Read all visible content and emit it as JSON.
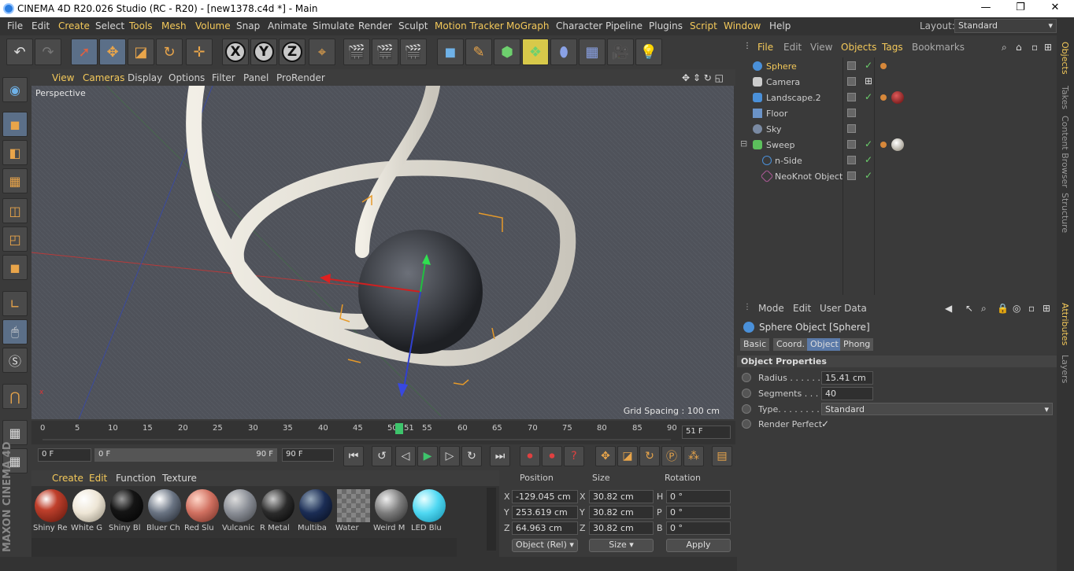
{
  "window": {
    "title": "CINEMA 4D R20.026 Studio (RC - R20) - [new1378.c4d *] - Main",
    "minimize": "—",
    "maximize": "❐",
    "close": "✕"
  },
  "menubar": {
    "items": [
      "File",
      "Edit",
      "Create",
      "Select",
      "Tools",
      "Mesh",
      "Volume",
      "Snap",
      "Animate",
      "Simulate",
      "Render",
      "Sculpt",
      "Motion Tracker",
      "MoGraph",
      "Character",
      "Pipeline",
      "Plugins",
      "Script",
      "Window",
      "Help"
    ],
    "layout_label": "Layout:",
    "layout_value": "Standard"
  },
  "viewport_menu": [
    "View",
    "Cameras",
    "Display",
    "Options",
    "Filter",
    "Panel",
    "ProRender"
  ],
  "viewport": {
    "label": "Perspective",
    "grid_spacing": "Grid Spacing : 100 cm"
  },
  "timeline": {
    "ticks": [
      "0",
      "5",
      "10",
      "15",
      "20",
      "25",
      "30",
      "35",
      "40",
      "45",
      "50",
      "51",
      "55",
      "60",
      "65",
      "70",
      "75",
      "80",
      "85",
      "90"
    ],
    "current_frame": "51 F",
    "start_field": "0 F",
    "range_start": "0 F",
    "range_end": "90 F",
    "end_field": "90 F"
  },
  "material_menu": [
    "Create",
    "Edit",
    "Function",
    "Texture"
  ],
  "materials": [
    {
      "name": "Shiny Re",
      "color": "#c0402c"
    },
    {
      "name": "White G",
      "color": "#eee6d6"
    },
    {
      "name": "Shiny Bl",
      "color": "#151515"
    },
    {
      "name": "Bluer Ch",
      "color": "#6a7483"
    },
    {
      "name": "Red Slu",
      "color": "#d07060"
    },
    {
      "name": "Vulcanic",
      "color": "#8a8e96"
    },
    {
      "name": "R Metal",
      "color": "#2b2b2b"
    },
    {
      "name": "Multiba",
      "color": "#1b2d55"
    },
    {
      "name": "Water",
      "color": "#707070"
    },
    {
      "name": "Weird M",
      "color": "#7d7d7d"
    },
    {
      "name": "LED Blu",
      "color": "#4fd8f2"
    }
  ],
  "coords": {
    "headers": [
      "Position",
      "Size",
      "Rotation"
    ],
    "rows": [
      {
        "axis": "X",
        "pos": "-129.045 cm",
        "saxis": "X",
        "size": "30.82 cm",
        "raxis": "H",
        "rot": "0 °"
      },
      {
        "axis": "Y",
        "pos": "253.619 cm",
        "saxis": "Y",
        "size": "30.82 cm",
        "raxis": "P",
        "rot": "0 °"
      },
      {
        "axis": "Z",
        "pos": "64.963 cm",
        "saxis": "Z",
        "size": "30.82 cm",
        "raxis": "B",
        "rot": "0 °"
      }
    ],
    "mode": "Object (Rel)",
    "size_mode": "Size",
    "apply": "Apply"
  },
  "object_menu": [
    "File",
    "Edit",
    "View",
    "Objects",
    "Tags",
    "Bookmarks"
  ],
  "objects": [
    {
      "name": "Sphere",
      "selected": true,
      "icon_color": "#4a90d9",
      "indent": 0
    },
    {
      "name": "Camera",
      "selected": false,
      "icon_color": "#cccccc",
      "indent": 0
    },
    {
      "name": "Landscape.2",
      "selected": false,
      "icon_color": "#4a90d9",
      "indent": 0
    },
    {
      "name": "Floor",
      "selected": false,
      "icon_color": "#6b93c7",
      "indent": 0
    },
    {
      "name": "Sky",
      "selected": false,
      "icon_color": "#7a8aa3",
      "indent": 0
    },
    {
      "name": "Sweep",
      "selected": false,
      "icon_color": "#5cc05c",
      "indent": 0
    },
    {
      "name": "n-Side",
      "selected": false,
      "icon_color": "#4a90d9",
      "indent": 1
    },
    {
      "name": "NeoKnot Object",
      "selected": false,
      "icon_color": "#b05a9a",
      "indent": 1
    }
  ],
  "attr_menu": [
    "Mode",
    "Edit",
    "User Data"
  ],
  "attributes": {
    "title": "Sphere Object [Sphere]",
    "tabs": [
      "Basic",
      "Coord.",
      "Object",
      "Phong"
    ],
    "active_tab": "Object",
    "section": "Object Properties",
    "props": [
      {
        "label": "Radius . . . . . . .",
        "value": "15.41 cm"
      },
      {
        "label": "Segments . . . .",
        "value": "40"
      },
      {
        "label": "Type. . . . . . . . .",
        "value": "Standard"
      },
      {
        "label": "Render Perfect",
        "value": "✓"
      }
    ]
  },
  "right_tabs": [
    "Objects",
    "Takes",
    "Content Browser",
    "Structure",
    "Attributes",
    "Layers"
  ],
  "brand": "MAXON CINEMA 4D"
}
